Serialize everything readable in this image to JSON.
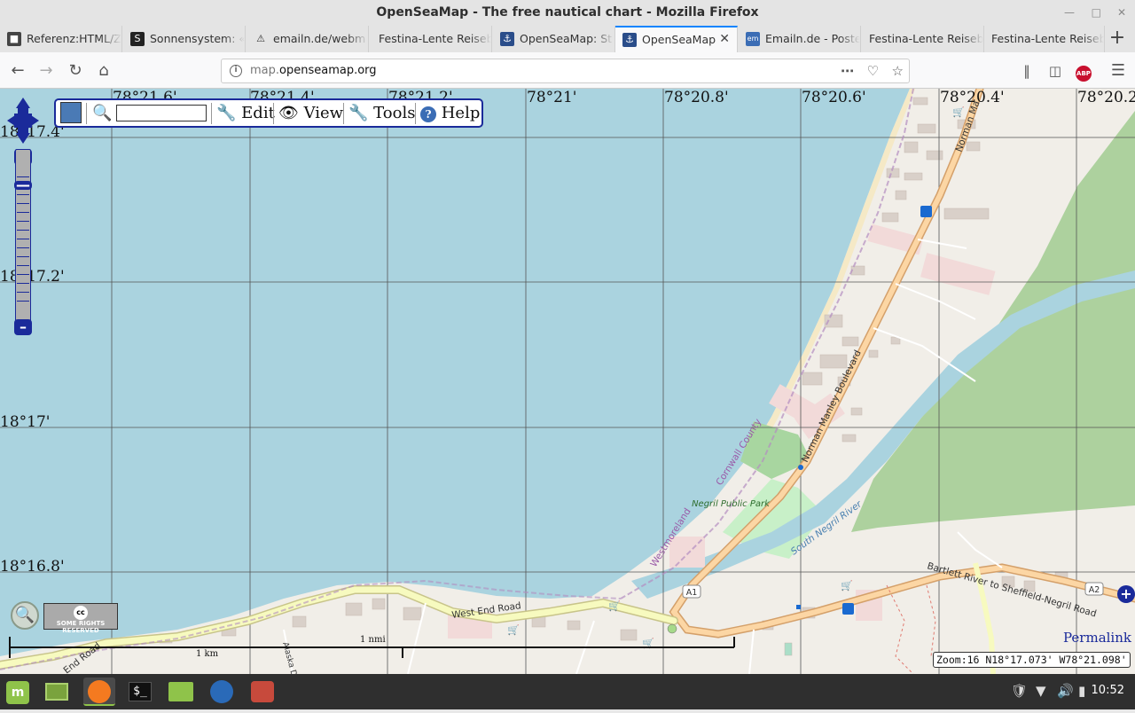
{
  "window": {
    "title": "OpenSeaMap - The free nautical chart - Mozilla Firefox"
  },
  "tabs": [
    {
      "label": "Referenz:HTML/Z",
      "icon": "wiki-icon",
      "active": false
    },
    {
      "label": "Sonnensystem: «",
      "icon": "s-site-icon",
      "active": false
    },
    {
      "label": "emailn.de/webm",
      "icon": "warning-icon",
      "active": false
    },
    {
      "label": "Festina-Lente Reisebl",
      "icon": "",
      "active": false
    },
    {
      "label": "OpenSeaMap: St",
      "icon": "openseamap-icon",
      "active": false
    },
    {
      "label": "OpenSeaMap",
      "icon": "openseamap-icon",
      "active": true
    },
    {
      "label": "Emailn.de - Poste",
      "icon": "emailn-icon",
      "active": false
    },
    {
      "label": "Festina-Lente Reisebl",
      "icon": "",
      "active": false
    },
    {
      "label": "Festina-Lente Reisebl",
      "icon": "",
      "active": false
    }
  ],
  "navbar": {
    "url_host": "map.",
    "url_domain": "openseamap.org"
  },
  "map": {
    "toolbar": {
      "edit": "Edit",
      "view": "View",
      "tools": "Tools",
      "help": "Help",
      "search_value": ""
    },
    "lon_labels": [
      "78°21.6'",
      "78°21.4'",
      "78°21.2'",
      "78°21'",
      "78°20.8'",
      "78°20.6'",
      "78°20.4'",
      "78°20.2'"
    ],
    "lat_labels": [
      "18°17.4'",
      "18°17.2'",
      "18°17'",
      "18°16.8'"
    ],
    "place_labels": {
      "norman_manley": "Norman Manley Boulevard",
      "norman_ma": "Norman Ma",
      "cornwall": "Cornwall County",
      "westmoreland": "Westmoreland",
      "park": "Negril Public Park",
      "river": "South Negril River",
      "bartlett": "Bartlett River to Sheffield-Negril Road",
      "west_end": "West End Road",
      "end_road": "End Road",
      "a1": "A1",
      "a2": "A2",
      "alaska": "Alaska D",
      "nmi_label": "1 nmi",
      "km_label": "1 km"
    },
    "license": "SOME RIGHTS RESERVED",
    "permalink": "Permalink",
    "position": "Zoom:16 N18°17.073' W78°21.098'",
    "colors": {
      "sea": "#aad3df",
      "land": "#f1eee8",
      "forest": "#add19e",
      "road": "#fcd6a4",
      "river": "#aad3df",
      "accent": "#1a2a9a"
    }
  },
  "taskbar": {
    "apps": [
      "mint-menu-icon",
      "show-desktop-icon",
      "firefox-icon",
      "terminal-icon",
      "files-icon",
      "thunderbird-icon",
      "gimp-icon"
    ],
    "clock": "10:52"
  }
}
